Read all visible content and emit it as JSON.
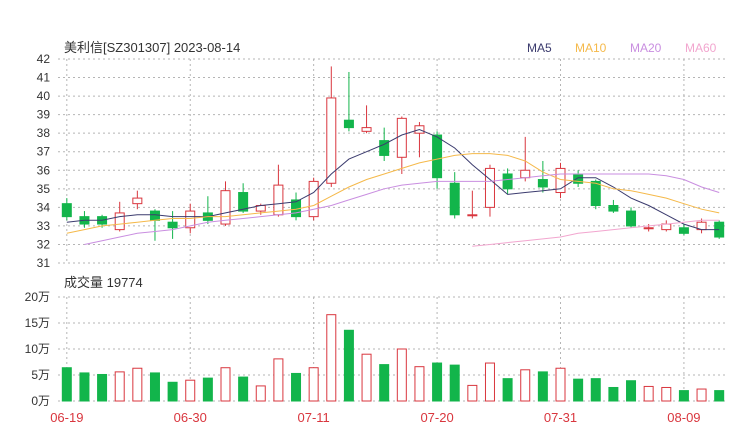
{
  "header": {
    "title": "美利信[SZ301307] 2023-08-14",
    "legend": [
      {
        "label": "MA5",
        "color": "#3b3b6e"
      },
      {
        "label": "MA10",
        "color": "#f5b94a"
      },
      {
        "label": "MA20",
        "color": "#c98ee0"
      },
      {
        "label": "MA60",
        "color": "#f2a6cf"
      }
    ]
  },
  "volume_label": "成交量 19774",
  "colors": {
    "up": "#d9363e",
    "down": "#12b54b",
    "grid": "#b5b5b5"
  },
  "chart_data": [
    {
      "type": "candlestick",
      "ylim": [
        31,
        42
      ],
      "yticks": [
        31,
        32,
        33,
        34,
        35,
        36,
        37,
        38,
        39,
        40,
        41,
        42
      ],
      "candles": [
        {
          "o": 34.2,
          "c": 33.5,
          "h": 34.5,
          "l": 33.3
        },
        {
          "o": 33.5,
          "c": 33.1,
          "h": 33.8,
          "l": 32.9
        },
        {
          "o": 33.5,
          "c": 33.1,
          "h": 33.6,
          "l": 32.9
        },
        {
          "o": 32.8,
          "c": 33.7,
          "h": 34.3,
          "l": 32.7
        },
        {
          "o": 34.2,
          "c": 34.5,
          "h": 34.9,
          "l": 33.9
        },
        {
          "o": 33.8,
          "c": 33.3,
          "h": 33.9,
          "l": 32.2
        },
        {
          "o": 33.2,
          "c": 32.9,
          "h": 33.8,
          "l": 32.3
        },
        {
          "o": 32.9,
          "c": 33.8,
          "h": 34.2,
          "l": 32.6
        },
        {
          "o": 33.7,
          "c": 33.3,
          "h": 34.6,
          "l": 33.1
        },
        {
          "o": 33.1,
          "c": 34.9,
          "h": 35.4,
          "l": 33.0
        },
        {
          "o": 34.8,
          "c": 33.8,
          "h": 35.3,
          "l": 33.7
        },
        {
          "o": 33.8,
          "c": 34.1,
          "h": 34.2,
          "l": 33.6
        },
        {
          "o": 33.6,
          "c": 35.2,
          "h": 36.3,
          "l": 33.5
        },
        {
          "o": 34.4,
          "c": 33.5,
          "h": 34.8,
          "l": 33.3
        },
        {
          "o": 33.5,
          "c": 35.4,
          "h": 35.6,
          "l": 33.3
        },
        {
          "o": 35.3,
          "c": 39.9,
          "h": 41.6,
          "l": 35.1
        },
        {
          "o": 38.7,
          "c": 38.3,
          "h": 41.3,
          "l": 38.1
        },
        {
          "o": 38.1,
          "c": 38.3,
          "h": 39.5,
          "l": 38.0
        },
        {
          "o": 37.6,
          "c": 36.8,
          "h": 38.3,
          "l": 36.5
        },
        {
          "o": 36.7,
          "c": 38.8,
          "h": 38.9,
          "l": 35.8
        },
        {
          "o": 38.0,
          "c": 38.4,
          "h": 38.6,
          "l": 36.7
        },
        {
          "o": 37.9,
          "c": 35.6,
          "h": 38.1,
          "l": 35.0
        },
        {
          "o": 35.3,
          "c": 33.6,
          "h": 35.9,
          "l": 33.4
        },
        {
          "o": 33.6,
          "c": 33.6,
          "h": 34.9,
          "l": 33.4
        },
        {
          "o": 34.0,
          "c": 36.1,
          "h": 36.3,
          "l": 33.5
        },
        {
          "o": 35.8,
          "c": 35.0,
          "h": 36.1,
          "l": 34.7
        },
        {
          "o": 35.6,
          "c": 36.0,
          "h": 37.8,
          "l": 35.4
        },
        {
          "o": 35.5,
          "c": 35.1,
          "h": 36.5,
          "l": 34.8
        },
        {
          "o": 34.8,
          "c": 36.1,
          "h": 36.4,
          "l": 34.5
        },
        {
          "o": 35.8,
          "c": 35.3,
          "h": 36.0,
          "l": 35.1
        },
        {
          "o": 35.4,
          "c": 34.1,
          "h": 35.5,
          "l": 33.9
        },
        {
          "o": 34.1,
          "c": 33.8,
          "h": 34.4,
          "l": 33.7
        },
        {
          "o": 33.8,
          "c": 33.0,
          "h": 34.0,
          "l": 32.9
        },
        {
          "o": 32.9,
          "c": 32.9,
          "h": 33.1,
          "l": 32.7
        },
        {
          "o": 32.8,
          "c": 33.1,
          "h": 33.3,
          "l": 32.7
        },
        {
          "o": 32.9,
          "c": 32.6,
          "h": 33.1,
          "l": 32.5
        },
        {
          "o": 32.8,
          "c": 33.2,
          "h": 33.4,
          "l": 32.6
        },
        {
          "o": 33.2,
          "c": 32.4,
          "h": 33.3,
          "l": 32.3
        }
      ],
      "ma": {
        "MA5": [
          33.2,
          33.3,
          33.3,
          33.5,
          33.6,
          33.6,
          33.5,
          33.5,
          33.5,
          33.7,
          33.9,
          34.1,
          34.2,
          34.3,
          34.8,
          35.8,
          36.6,
          37.0,
          37.4,
          37.9,
          38.2,
          37.8,
          37.2,
          36.3,
          35.5,
          34.7,
          34.8,
          34.9,
          35.0,
          35.6,
          35.6,
          35.1,
          34.5,
          34.1,
          33.6,
          33.1,
          32.8,
          32.8
        ],
        "MA10": [
          32.6,
          32.8,
          33.0,
          33.1,
          33.2,
          33.3,
          33.4,
          33.4,
          33.5,
          33.5,
          33.6,
          33.7,
          33.8,
          33.9,
          34.1,
          34.6,
          35.1,
          35.5,
          35.8,
          36.1,
          36.4,
          36.6,
          36.8,
          36.9,
          36.9,
          36.8,
          36.5,
          35.9,
          35.5,
          35.4,
          35.3,
          35.0,
          34.9,
          34.7,
          34.5,
          34.2,
          33.9,
          33.7
        ],
        "MA20": [
          null,
          32.0,
          32.2,
          32.4,
          32.6,
          32.7,
          32.8,
          33.0,
          33.2,
          33.3,
          33.4,
          33.5,
          33.6,
          33.7,
          33.9,
          34.1,
          34.4,
          34.7,
          35.0,
          35.2,
          35.3,
          35.4,
          35.4,
          35.4,
          35.4,
          35.5,
          35.6,
          35.7,
          35.8,
          35.8,
          35.8,
          35.8,
          35.8,
          35.8,
          35.7,
          35.5,
          35.1,
          34.8
        ],
        "MA60": [
          null,
          null,
          null,
          null,
          null,
          null,
          null,
          null,
          null,
          null,
          null,
          null,
          null,
          null,
          null,
          null,
          null,
          null,
          null,
          null,
          null,
          null,
          null,
          31.9,
          32.0,
          32.1,
          32.2,
          32.3,
          32.4,
          32.6,
          32.7,
          32.8,
          32.9,
          33.0,
          33.1,
          33.2,
          33.3,
          33.3
        ]
      }
    },
    {
      "type": "bar",
      "ylim": [
        0,
        20
      ],
      "ytick_values": [
        0,
        5,
        10,
        15,
        20
      ],
      "ytick_labels": [
        "0万",
        "5万",
        "10万",
        "15万",
        "20万"
      ],
      "values": [
        6.4,
        5.4,
        5.1,
        5.6,
        6.3,
        5.4,
        3.6,
        4.0,
        4.4,
        6.4,
        4.6,
        2.9,
        8.1,
        5.3,
        6.4,
        16.6,
        13.6,
        9.0,
        7.0,
        10.0,
        6.6,
        7.3,
        6.9,
        3.0,
        7.3,
        4.3,
        6.0,
        5.6,
        6.3,
        4.2,
        4.3,
        2.6,
        3.9,
        2.8,
        2.6,
        2.0,
        2.3,
        2.0
      ],
      "x_tick_labels": [
        {
          "index": 0,
          "label": "06-19"
        },
        {
          "index": 7,
          "label": "06-30"
        },
        {
          "index": 14,
          "label": "07-11"
        },
        {
          "index": 21,
          "label": "07-20"
        },
        {
          "index": 28,
          "label": "07-31"
        },
        {
          "index": 35,
          "label": "08-09"
        }
      ]
    }
  ]
}
